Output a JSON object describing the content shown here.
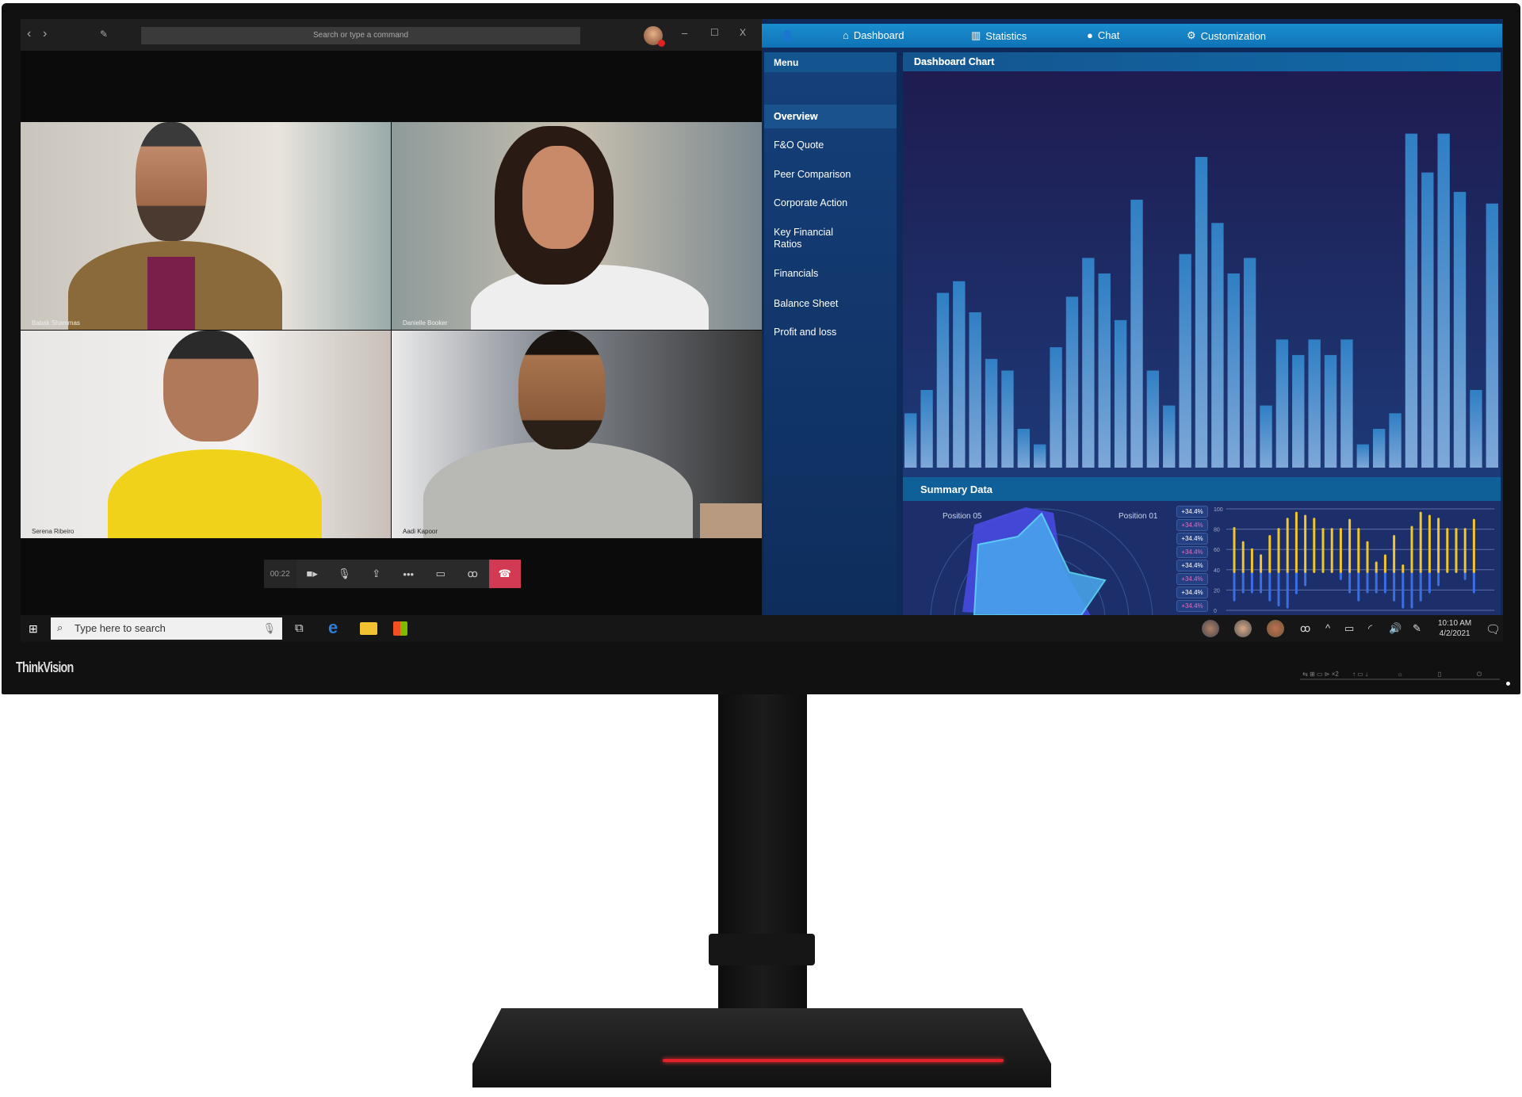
{
  "teams": {
    "search_placeholder": "Search or type a command",
    "nav_back": "‹",
    "nav_fwd": "›",
    "compose": "✎",
    "minimize": "–",
    "maximize": "☐",
    "close": "X",
    "participants": [
      {
        "name": "Babak Shammas"
      },
      {
        "name": "Danielle Booker"
      },
      {
        "name": "Serena Ribeiro"
      },
      {
        "name": "Aadi Kapoor"
      }
    ],
    "call": {
      "timer": "00:22",
      "camera": "■▸",
      "mic": "🎙",
      "share": "⇪",
      "more": "•••",
      "chat": "▭",
      "people": "ꝏ",
      "hangup": "☎"
    }
  },
  "dashboard": {
    "nav": [
      {
        "label": "Dashboard",
        "icon": "home-icon"
      },
      {
        "label": "Statistics",
        "icon": "bar-chart-icon"
      },
      {
        "label": "Chat",
        "icon": "chat-bubble-icon"
      },
      {
        "label": "Customization",
        "icon": "gear-icon"
      }
    ],
    "menu_title": "Menu",
    "menu": [
      "Overview",
      "F&O Quote",
      "Peer Comparison",
      "Corporate Action",
      "Key Financial Ratios",
      "Financials",
      "Balance Sheet",
      "Profit and loss"
    ],
    "active_menu": "Overview",
    "chart_title": "Dashboard Chart",
    "summary_title": "Summary Data",
    "radar_labels": [
      "Position 05",
      "Position 01"
    ],
    "badges": [
      "+34.4%",
      "+34.4%",
      "+34.4%",
      "+34.4%",
      "+34.4%",
      "+34.4%",
      "+34.4%",
      "+34.4%"
    ],
    "colors": {
      "nav": "#1a8ed0",
      "bars": "#3a86c8",
      "yellow": "#f2c62a",
      "blue": "#3b6fe0"
    }
  },
  "chart_data": [
    {
      "type": "bar",
      "title": "Dashboard Chart",
      "values": [
        14,
        20,
        45,
        48,
        40,
        28,
        25,
        10,
        6,
        31,
        44,
        54,
        50,
        38,
        69,
        25,
        16,
        55,
        80,
        63,
        50,
        54,
        16,
        33,
        29,
        33,
        29,
        33,
        6,
        10,
        14,
        86,
        76,
        86,
        71,
        20,
        68
      ],
      "grid": false
    },
    {
      "type": "bar",
      "yticks": [
        0,
        20,
        40,
        60,
        80,
        100
      ],
      "ylim": [
        0,
        100
      ],
      "baseline": 38,
      "series": [
        {
          "values": [
            81,
            67,
            60,
            54,
            73,
            80,
            90,
            96,
            93,
            90,
            80,
            80,
            80,
            89,
            80,
            67,
            47,
            54,
            73,
            44,
            82,
            96,
            93,
            90,
            80,
            80,
            80,
            89
          ]
        },
        {
          "values": [
            10,
            18,
            18,
            18,
            10,
            5,
            3,
            17,
            25,
            38,
            38,
            38,
            31,
            18,
            10,
            18,
            18,
            18,
            10,
            3,
            3,
            10,
            18,
            25,
            38,
            38,
            31,
            18
          ]
        }
      ],
      "grid": true
    },
    {
      "type": "radar",
      "labels": [
        "Position 05",
        "Position 01"
      ]
    }
  ],
  "taskbar": {
    "search_placeholder": "Type here to search",
    "time": "10:10 AM",
    "date": "4/2/2021"
  },
  "monitor": {
    "brand": "ThinkVision",
    "buttons": [
      "⇆ ⊞ ▭ ⊳ ×2",
      "↑ ▭ ↓",
      "☼",
      "▯",
      "⏻"
    ]
  }
}
